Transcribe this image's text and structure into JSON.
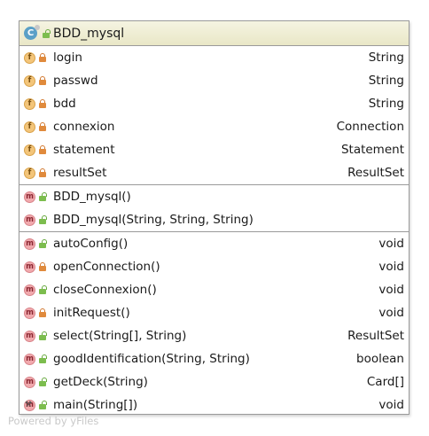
{
  "class": {
    "icon_letter": "C",
    "name": "BDD_mysql",
    "fields": [
      {
        "kind": "f",
        "visibility": "private",
        "name": "login",
        "type": "String"
      },
      {
        "kind": "f",
        "visibility": "private",
        "name": "passwd",
        "type": "String"
      },
      {
        "kind": "f",
        "visibility": "private",
        "name": "bdd",
        "type": "String"
      },
      {
        "kind": "f",
        "visibility": "private",
        "name": "connexion",
        "type": "Connection"
      },
      {
        "kind": "f",
        "visibility": "private",
        "name": "statement",
        "type": "Statement"
      },
      {
        "kind": "f",
        "visibility": "private",
        "name": "resultSet",
        "type": "ResultSet"
      }
    ],
    "constructors": [
      {
        "kind": "m",
        "visibility": "public",
        "name": "BDD_mysql()",
        "type": ""
      },
      {
        "kind": "m",
        "visibility": "public",
        "name": "BDD_mysql(String, String, String)",
        "type": ""
      }
    ],
    "methods": [
      {
        "kind": "m",
        "visibility": "public",
        "name": "autoConfig()",
        "type": "void"
      },
      {
        "kind": "m",
        "visibility": "private",
        "name": "openConnection()",
        "type": "void"
      },
      {
        "kind": "m",
        "visibility": "public",
        "name": "closeConnexion()",
        "type": "void"
      },
      {
        "kind": "m",
        "visibility": "private",
        "name": "initRequest()",
        "type": "void"
      },
      {
        "kind": "m",
        "visibility": "public",
        "name": "select(String[], String)",
        "type": "ResultSet"
      },
      {
        "kind": "m",
        "visibility": "public",
        "name": "goodIdentification(String, String)",
        "type": "boolean"
      },
      {
        "kind": "m",
        "visibility": "public",
        "name": "getDeck(String)",
        "type": "Card[]"
      },
      {
        "kind": "m",
        "visibility": "public",
        "name": "main(String[])",
        "type": "void",
        "static": true
      }
    ]
  },
  "watermark": "Powered by yFiles"
}
